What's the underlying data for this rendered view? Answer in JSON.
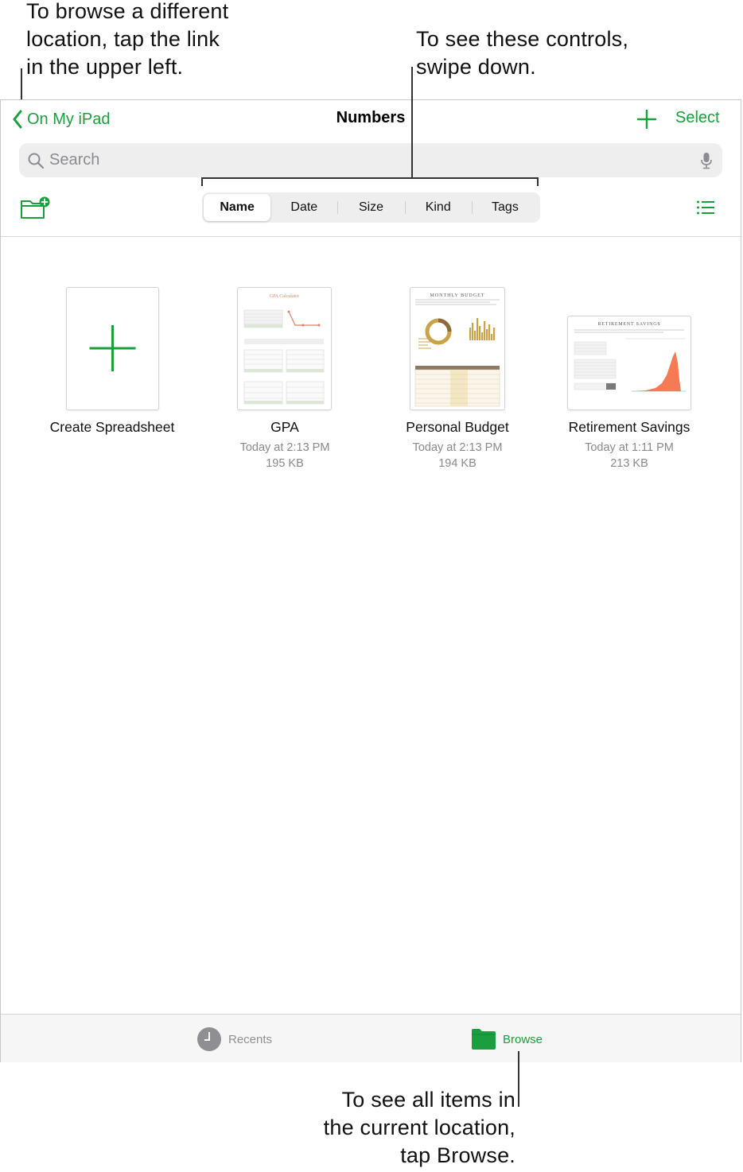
{
  "callouts": {
    "browse_location": [
      "To browse a different",
      "location, tap the link",
      "in the upper left."
    ],
    "swipe_controls": [
      "To see these controls,",
      "swipe down."
    ],
    "tap_browse": [
      "To see all items in",
      "the current location,",
      "tap Browse."
    ]
  },
  "navbar": {
    "back_label": "On My iPad",
    "title": "Numbers",
    "select_label": "Select"
  },
  "search": {
    "placeholder": "Search"
  },
  "sort_options": [
    "Name",
    "Date",
    "Size",
    "Kind",
    "Tags"
  ],
  "sort_selected": "Name",
  "documents": [
    {
      "name": "Create Spreadsheet",
      "date": "",
      "size": ""
    },
    {
      "name": "GPA",
      "date": "Today at 2:13 PM",
      "size": "195 KB"
    },
    {
      "name": "Personal Budget",
      "date": "Today at 2:13 PM",
      "size": "194 KB"
    },
    {
      "name": "Retirement Savings",
      "date": "Today at 1:11 PM",
      "size": "213 KB"
    }
  ],
  "tabs": {
    "recents": "Recents",
    "browse": "Browse"
  },
  "thumbnail_titles": {
    "gpa": "GPA Calculator",
    "budget": "MONTHLY BUDGET",
    "retirement": "RETIREMENT SAVINGS"
  },
  "colors": {
    "accent": "#1a9e3e",
    "gpa_accent": "#d9846a",
    "budget_accent": "#c9a24a",
    "retirement_accent": "#f47b54"
  },
  "icons": {
    "back": "chevron-left-icon",
    "add": "plus-icon",
    "search": "magnifier-icon",
    "mic": "microphone-icon",
    "new_folder": "folder-badge-plus-icon",
    "list": "list-icon",
    "recents": "clock-icon",
    "browse": "folder-icon"
  }
}
